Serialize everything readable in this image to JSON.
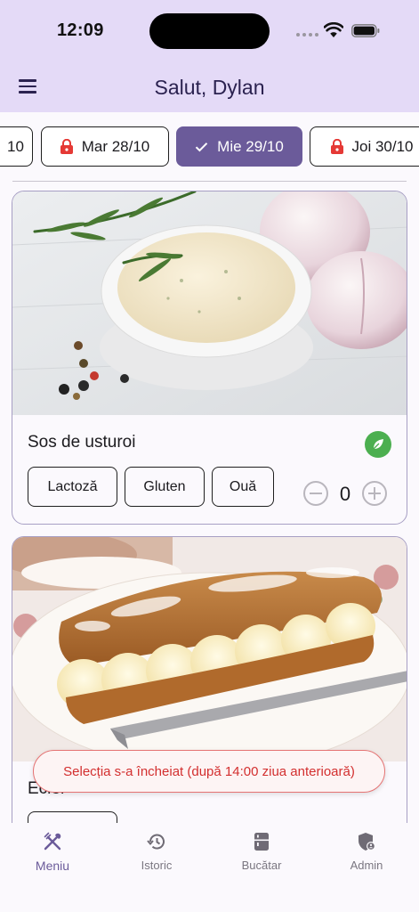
{
  "status": {
    "time": "12:09"
  },
  "header": {
    "greeting": "Salut, Dylan"
  },
  "dates": [
    {
      "label": "10",
      "locked": false,
      "selected": false
    },
    {
      "label": "Mar 28/10",
      "locked": true,
      "selected": false
    },
    {
      "label": "Mie 29/10",
      "locked": false,
      "selected": true
    },
    {
      "label": "Joi 30/10",
      "locked": true,
      "selected": false
    }
  ],
  "menu_items": [
    {
      "name": "Sos de usturoi",
      "vegetarian": true,
      "allergens": [
        "Lactoză",
        "Gluten",
        "Ouă"
      ],
      "quantity": "0"
    },
    {
      "name": "Ecler"
    }
  ],
  "toast": {
    "message": "Selecția s-a încheiat (după 14:00 ziua anterioară)"
  },
  "nav": {
    "items": [
      {
        "label": "Meniu",
        "icon": "cutlery-icon",
        "active": true
      },
      {
        "label": "Istoric",
        "icon": "history-icon",
        "active": false
      },
      {
        "label": "Bucătar",
        "icon": "fridge-icon",
        "active": false
      },
      {
        "label": "Admin",
        "icon": "admin-shield-icon",
        "active": false
      }
    ]
  },
  "colors": {
    "accent": "#6b5b9a",
    "header_bg": "#e4daf7",
    "error": "#d32f2f",
    "veg": "#4caf50"
  }
}
